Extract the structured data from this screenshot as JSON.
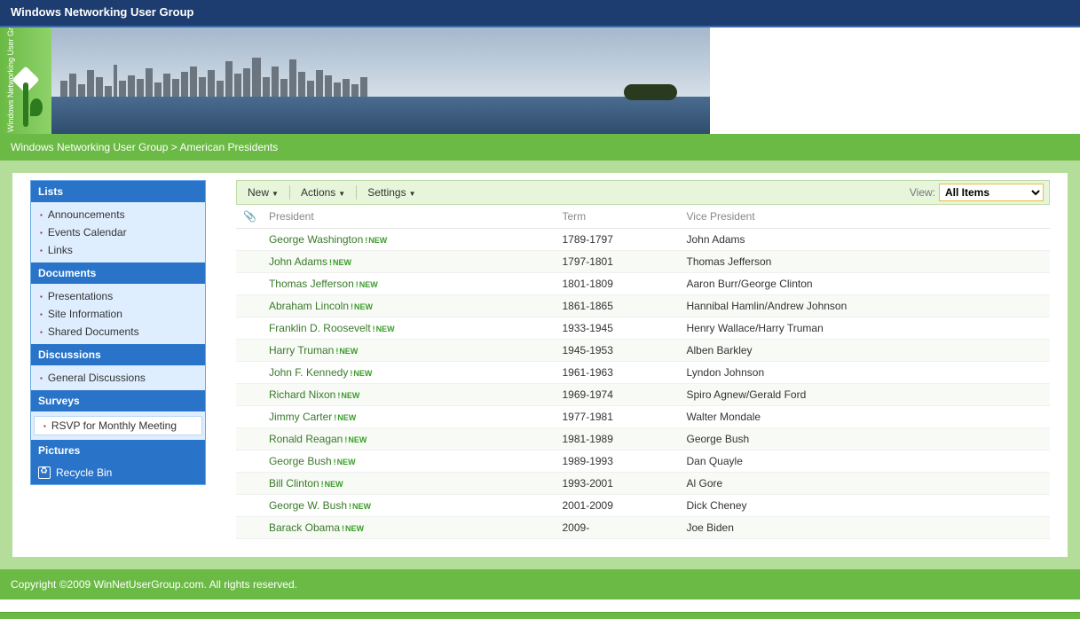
{
  "header": {
    "title": "Windows Networking User Group"
  },
  "banner": {
    "logoText": "Windows Networking User Group"
  },
  "breadcrumb": {
    "root": "Windows Networking User Group",
    "separator": ">",
    "current": "American Presidents"
  },
  "sidebar": {
    "sections": [
      {
        "title": "Lists",
        "items": [
          "Announcements",
          "Events Calendar",
          "Links"
        ]
      },
      {
        "title": "Documents",
        "items": [
          "Presentations",
          "Site Information",
          "Shared Documents"
        ]
      },
      {
        "title": "Discussions",
        "items": [
          "General Discussions"
        ]
      },
      {
        "title": "Surveys",
        "items": [
          "RSVP for Monthly Meeting"
        ],
        "highlight": true
      },
      {
        "title": "Pictures",
        "items": []
      }
    ],
    "recycle": "Recycle Bin"
  },
  "toolbar": {
    "new": "New",
    "actions": "Actions",
    "settings": "Settings",
    "viewLabel": "View:",
    "viewSelected": "All Items"
  },
  "table": {
    "columns": {
      "president": "President",
      "term": "Term",
      "vp": "Vice President"
    },
    "newBadge": "NEW",
    "rows": [
      {
        "president": "George Washington",
        "term": "1789-1797",
        "vp": "John Adams"
      },
      {
        "president": "John Adams",
        "term": "1797-1801",
        "vp": "Thomas Jefferson"
      },
      {
        "president": "Thomas Jefferson",
        "term": "1801-1809",
        "vp": "Aaron Burr/George Clinton"
      },
      {
        "president": "Abraham Lincoln",
        "term": "1861-1865",
        "vp": "Hannibal Hamlin/Andrew Johnson"
      },
      {
        "president": "Franklin D. Roosevelt",
        "term": "1933-1945",
        "vp": "Henry Wallace/Harry Truman"
      },
      {
        "president": "Harry Truman",
        "term": "1945-1953",
        "vp": "Alben Barkley"
      },
      {
        "president": "John F. Kennedy",
        "term": "1961-1963",
        "vp": "Lyndon Johnson"
      },
      {
        "president": "Richard Nixon",
        "term": "1969-1974",
        "vp": "Spiro Agnew/Gerald Ford"
      },
      {
        "president": "Jimmy Carter",
        "term": "1977-1981",
        "vp": "Walter Mondale"
      },
      {
        "president": "Ronald Reagan",
        "term": "1981-1989",
        "vp": "George Bush"
      },
      {
        "president": "George Bush",
        "term": "1989-1993",
        "vp": "Dan Quayle"
      },
      {
        "president": "Bill Clinton",
        "term": "1993-2001",
        "vp": "Al Gore"
      },
      {
        "president": "George W. Bush",
        "term": "2001-2009",
        "vp": "Dick Cheney"
      },
      {
        "president": "Barack Obama",
        "term": "2009-",
        "vp": "Joe Biden"
      }
    ]
  },
  "footer": {
    "copyright": "Copyright ©2009 WinNetUserGroup.com. All rights reserved."
  }
}
